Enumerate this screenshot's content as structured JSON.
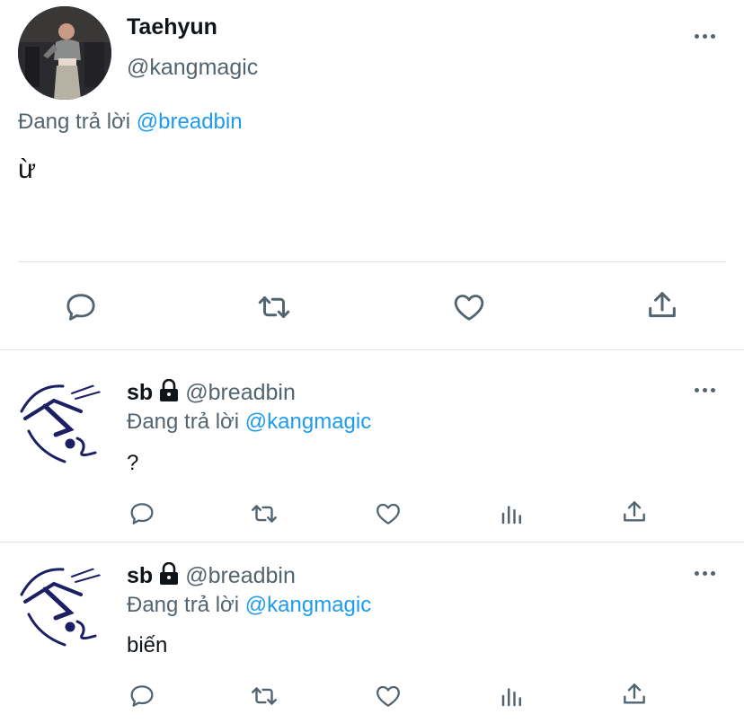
{
  "main_tweet": {
    "display_name": "Taehyun",
    "handle": "@kangmagic",
    "replying_prefix": "Đang trả lời",
    "replying_to": "@breadbin",
    "text": "ừ",
    "avatar_icon": "profile-photo"
  },
  "replies": [
    {
      "display_name": "sb",
      "handle": "@breadbin",
      "replying_prefix": "Đang trả lời",
      "replying_to": "@kangmagic",
      "text": "?",
      "lock_icon": "lock-icon"
    },
    {
      "display_name": "sb",
      "handle": "@breadbin",
      "replying_prefix": "Đang trả lời",
      "replying_to": "@kangmagic",
      "text": "biến",
      "lock_icon": "lock-icon"
    }
  ],
  "colors": {
    "link": "#1d9bf0",
    "secondary_text": "#536471",
    "divider": "#e1e6ea",
    "avatar_ink": "#1c1f63"
  }
}
